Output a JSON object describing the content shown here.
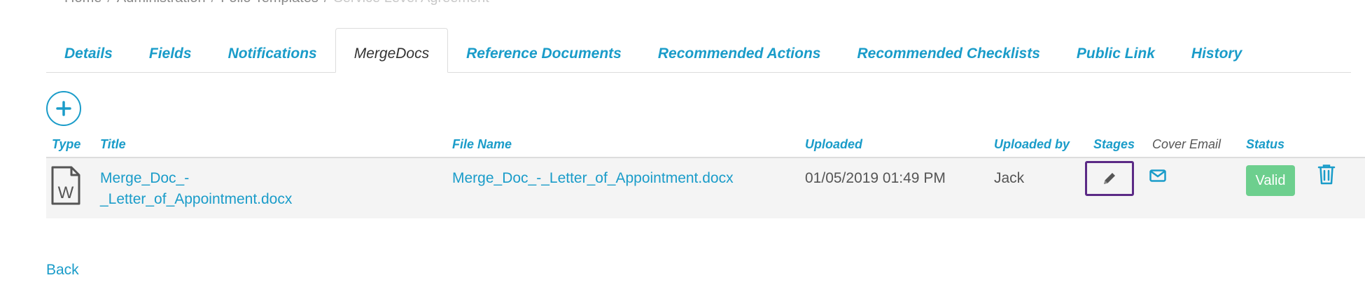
{
  "breadcrumb": {
    "items": [
      "Home",
      "Administration",
      "Folio Templates"
    ],
    "current": "Service Level Agreement"
  },
  "tabs": [
    {
      "label": "Details",
      "active": false
    },
    {
      "label": "Fields",
      "active": false
    },
    {
      "label": "Notifications",
      "active": false
    },
    {
      "label": "MergeDocs",
      "active": true
    },
    {
      "label": "Reference Documents",
      "active": false
    },
    {
      "label": "Recommended Actions",
      "active": false
    },
    {
      "label": "Recommended Checklists",
      "active": false
    },
    {
      "label": "Public Link",
      "active": false
    },
    {
      "label": "History",
      "active": false
    }
  ],
  "table": {
    "headers": {
      "type": "Type",
      "title": "Title",
      "file_name": "File Name",
      "uploaded": "Uploaded",
      "uploaded_by": "Uploaded by",
      "stages": "Stages",
      "cover_email": "Cover Email",
      "status": "Status"
    },
    "rows": [
      {
        "type_icon": "word-document-icon",
        "title_line1": "Merge_Doc_-",
        "title_line2": "_Letter_of_Appointment.docx",
        "file_name": "Merge_Doc_-_Letter_of_Appointment.docx",
        "uploaded": "01/05/2019 01:49 PM",
        "uploaded_by": "Jack",
        "stages_icon": "pencil-icon",
        "cover_email_icon": "envelope-icon",
        "status": "Valid",
        "delete_icon": "trash-icon"
      }
    ]
  },
  "back_label": "Back",
  "colors": {
    "link": "#1a9cc9",
    "valid": "#6dcf8e",
    "focus_border": "#5b2a86",
    "row_bg": "#f4f4f4"
  }
}
